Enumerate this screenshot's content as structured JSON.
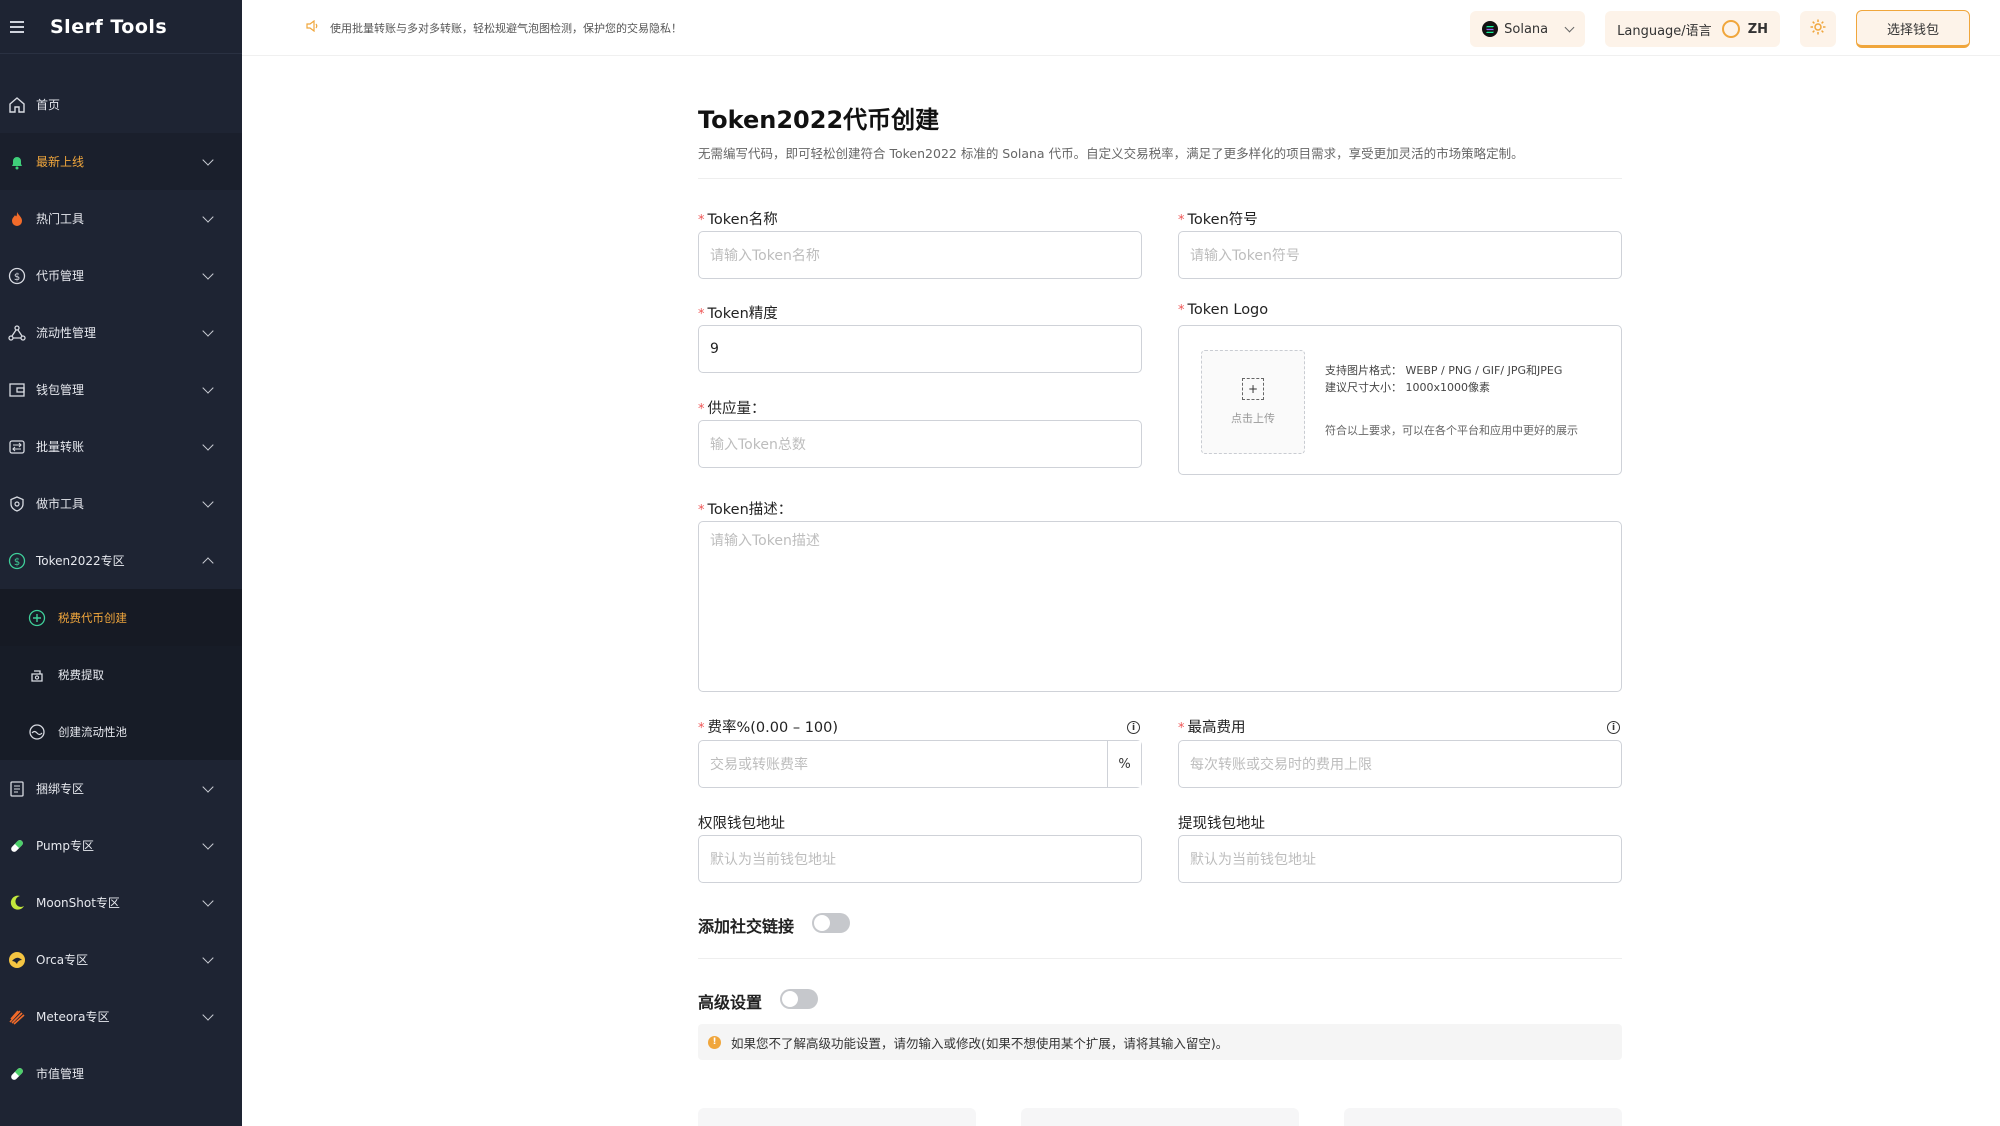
{
  "app": {
    "logo": "Slerf Tools"
  },
  "notice": {
    "text": "使用批量转账与多对多转账，轻松规避气泡图检测，保护您的交易隐私！"
  },
  "topbar": {
    "network": "Solana",
    "language_label": "Language/语言",
    "language_value": "ZH",
    "wallet_button": "选择钱包"
  },
  "sidebar": {
    "items": [
      {
        "label": "首页"
      },
      {
        "label": "最新上线"
      },
      {
        "label": "热门工具"
      },
      {
        "label": "代币管理"
      },
      {
        "label": "流动性管理"
      },
      {
        "label": "钱包管理"
      },
      {
        "label": "批量转账"
      },
      {
        "label": "做市工具"
      },
      {
        "label": "Token2022专区"
      },
      {
        "label": "捆绑专区"
      },
      {
        "label": "Pump专区"
      },
      {
        "label": "MoonShot专区"
      },
      {
        "label": "Orca专区"
      },
      {
        "label": "Meteora专区"
      },
      {
        "label": "市值管理"
      }
    ],
    "subitems": [
      {
        "label": "税费代币创建"
      },
      {
        "label": "税费提取"
      },
      {
        "label": "创建流动性池"
      }
    ]
  },
  "page": {
    "title": "Token2022代币创建",
    "description": "无需编写代码，即可轻松创建符合 Token2022 标准的 Solana 代币。自定义交易税率，满足了更多样化的项目需求，享受更加灵活的市场策略定制。"
  },
  "form": {
    "required_mark": "*",
    "name": {
      "label": "Token名称",
      "placeholder": "请输入Token名称"
    },
    "symbol": {
      "label": "Token符号",
      "placeholder": "请输入Token符号"
    },
    "decimals": {
      "label": "Token精度",
      "value": "9"
    },
    "logo": {
      "label": "Token Logo",
      "upload_label": "点击上传",
      "upload_plus": "+",
      "formats_line": "支持图片格式：   WEBP / PNG / GIF/ JPG和JPEG",
      "size_line": "建议尺寸大小：   1000x1000像素",
      "note": "符合以上要求，可以在各个平台和应用中更好的展示"
    },
    "supply": {
      "label": "供应量：",
      "placeholder": "输入Token总数"
    },
    "description": {
      "label": "Token描述：",
      "placeholder": "请输入Token描述"
    },
    "fee_rate": {
      "label": "费率%(0.00 – 100)",
      "placeholder": "交易或转账费率",
      "suffix": "%"
    },
    "max_fee": {
      "label": "最高费用",
      "placeholder": "每次转账或交易时的费用上限"
    },
    "authority_wallet": {
      "label": "权限钱包地址",
      "placeholder": "默认为当前钱包地址"
    },
    "withdraw_wallet": {
      "label": "提现钱包地址",
      "placeholder": "默认为当前钱包地址"
    },
    "social_toggle": {
      "label": "添加社交链接"
    },
    "advanced_toggle": {
      "label": "高级设置"
    },
    "advanced_alert": "如果您不了解高级功能设置，请勿输入或修改(如果不想使用某个扩展，请将其输入留空)。",
    "info_glyph": "i",
    "warn_glyph": "!"
  },
  "colors": {
    "accent": "#f0a63c",
    "sidebar_bg": "#1e2433",
    "required": "#e55555"
  }
}
